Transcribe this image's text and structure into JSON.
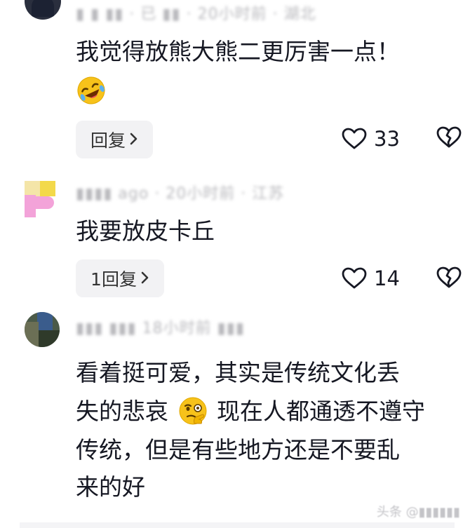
{
  "comments": [
    {
      "text": "我觉得放熊大熊二更厉害一点！",
      "emoji": "rolling-on-floor-laughing-emoji",
      "reply_label": "回复",
      "likes": "33"
    },
    {
      "meta": "▮▮▮▮ ago · 20小时前 · 江苏",
      "text": "我要放皮卡丘",
      "reply_label": "1回复",
      "likes": "14"
    },
    {
      "meta": "▮▮▮ ▮▮▮ 18小时前 ▮▮▮",
      "text_line1": "看着挺可爱，其实是传统文化丢",
      "text_line2a": "失的悲哀",
      "emoji": "thinking-face-emoji",
      "text_line2b": "现在人都通透不遵守",
      "text_line3": "传统，但是有些地方还是不要乱",
      "text_line4": "来的好"
    }
  ],
  "top_meta": "▮ ▮ ▮▮ · 已 ▮▮ · 20小时前 · 湖北",
  "watermark": "头条 @▮▮▮▮▮▮",
  "colors": {
    "reply_bg": "#f2f2f4",
    "text": "#161823",
    "meta": "#b8b8bc",
    "emoji_yellow": "#f7c21a"
  },
  "icons": [
    "heart-outline-icon",
    "broken-heart-icon",
    "chevron-right-icon"
  ]
}
